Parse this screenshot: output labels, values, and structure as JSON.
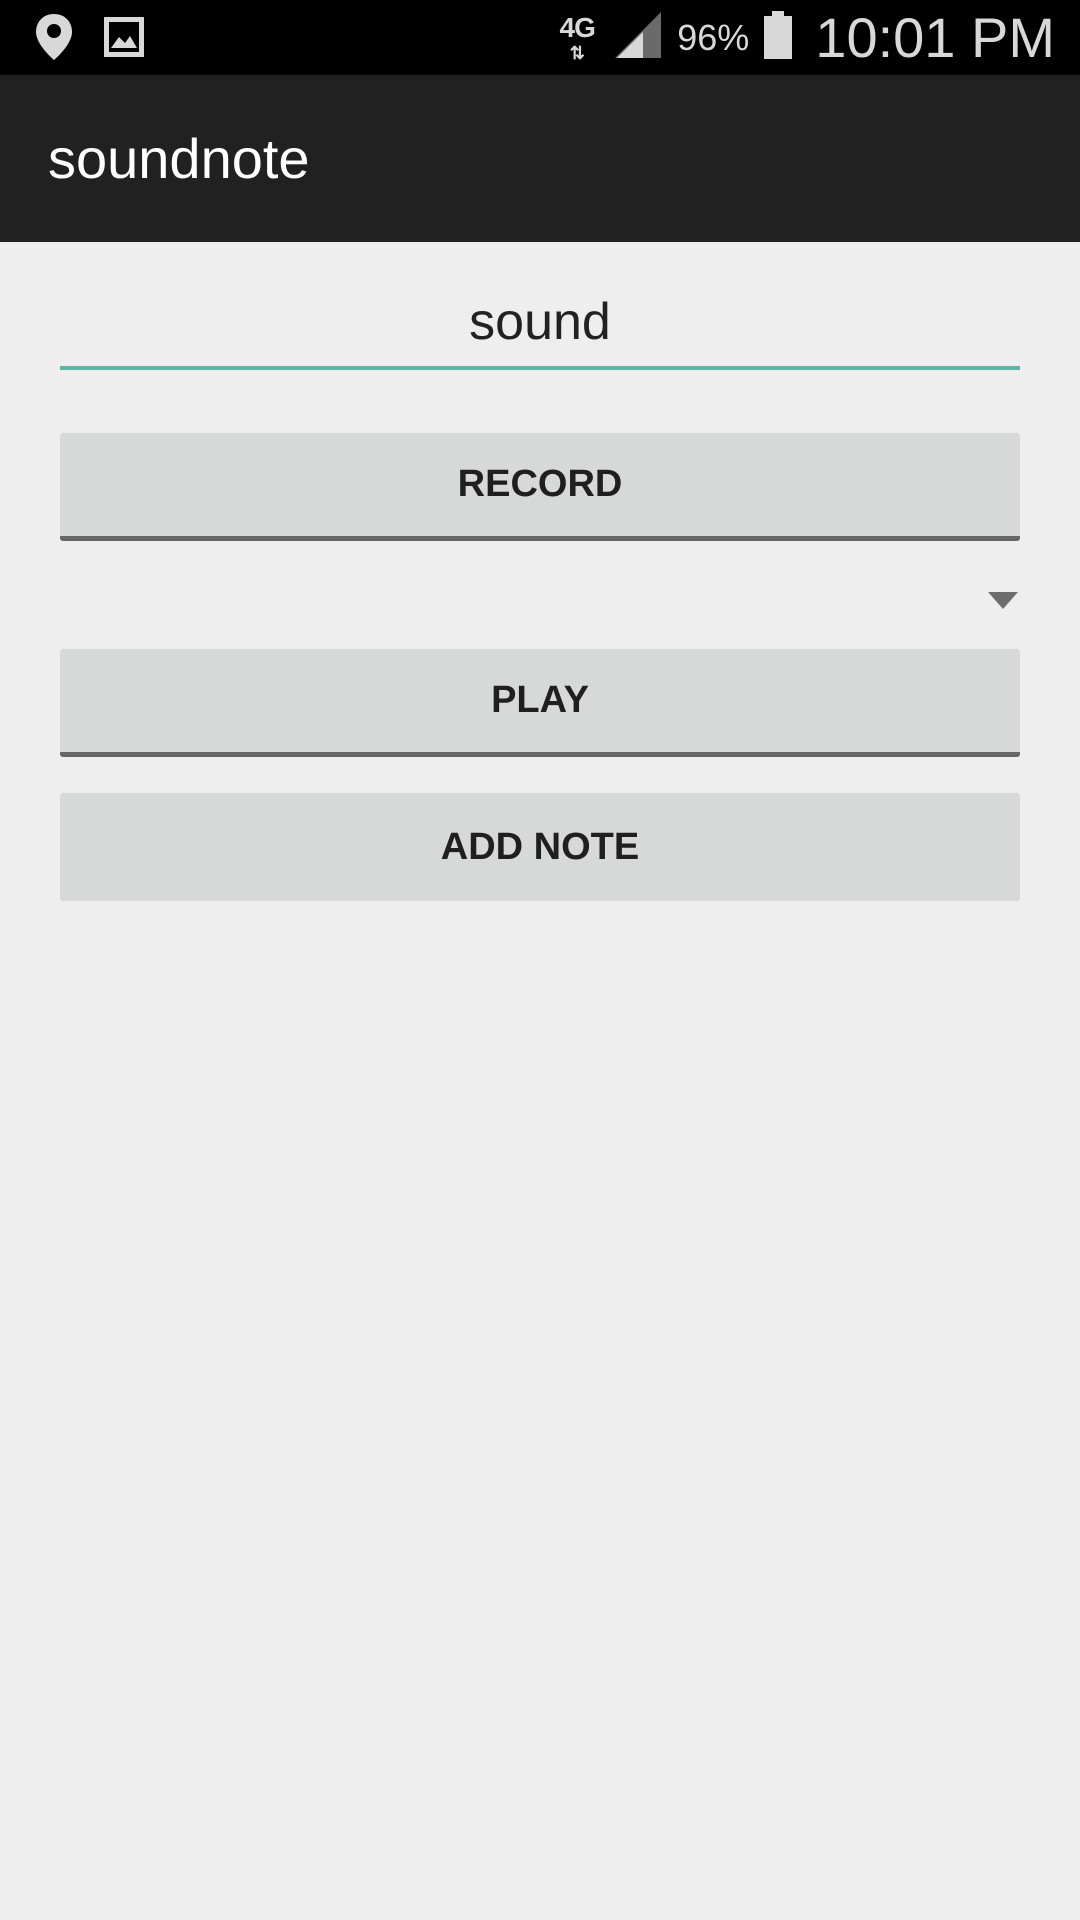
{
  "status_bar": {
    "network_type": "4G",
    "battery_percent": "96%",
    "time": "10:01 PM",
    "left_icons": [
      "location-icon",
      "image-icon"
    ],
    "right_icons": [
      "data-arrows-icon",
      "cell-signal-icon",
      "battery-icon"
    ]
  },
  "app": {
    "title": "soundnote"
  },
  "form": {
    "name_value": "sound",
    "record_label": "RECORD",
    "spinner_selected": "",
    "play_label": "PLAY",
    "add_note_label": "ADD NOTE"
  },
  "colors": {
    "status_bar_bg": "#000000",
    "action_bar_bg": "#212121",
    "page_bg": "#eeeeee",
    "button_bg": "#d7d8d8",
    "field_underline": "#5fb3a8"
  }
}
